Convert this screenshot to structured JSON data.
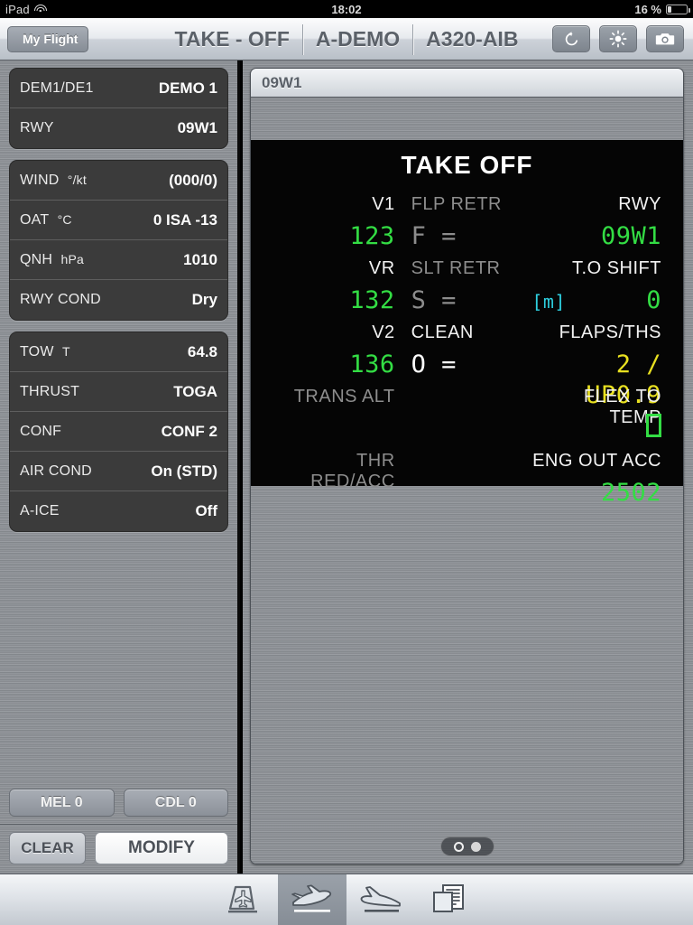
{
  "status_bar": {
    "device": "iPad",
    "wifi_icon": "wifi-icon",
    "time": "18:02",
    "battery_percent": "16 %",
    "battery_icon": "battery-low-icon"
  },
  "nav_bar": {
    "back_label": "My Flight",
    "title_segments": [
      "TAKE - OFF",
      "A-DEMO",
      "A320-AIB"
    ],
    "buttons": [
      {
        "name": "refresh-button",
        "icon": "refresh-icon"
      },
      {
        "name": "brightness-button",
        "icon": "brightness-icon"
      },
      {
        "name": "camera-button",
        "icon": "camera-icon"
      }
    ]
  },
  "sidebar": {
    "groups": [
      {
        "rows": [
          {
            "key": "DEM1/DE1",
            "unit": "",
            "value": "DEMO 1"
          },
          {
            "key": "RWY",
            "unit": "",
            "value": "09W1"
          }
        ]
      },
      {
        "rows": [
          {
            "key": "WIND",
            "unit": "°/kt",
            "value": "(000/0)"
          },
          {
            "key": "OAT",
            "unit": "°C",
            "value": "0 ISA -13"
          },
          {
            "key": "QNH",
            "unit": "hPa",
            "value": "1010"
          },
          {
            "key": "RWY COND",
            "unit": "",
            "value": "Dry"
          }
        ]
      },
      {
        "rows": [
          {
            "key": "TOW",
            "unit": "T",
            "value": "64.8"
          },
          {
            "key": "THRUST",
            "unit": "",
            "value": "TOGA"
          },
          {
            "key": "CONF",
            "unit": "",
            "value": "CONF 2"
          },
          {
            "key": "AIR COND",
            "unit": "",
            "value": "On (STD)"
          },
          {
            "key": "A-ICE",
            "unit": "",
            "value": "Off"
          }
        ]
      }
    ],
    "mel_label": "MEL 0",
    "cdl_label": "CDL 0",
    "clear_label": "CLEAR",
    "modify_label": "MODIFY"
  },
  "panel": {
    "header_title": "09W1",
    "display": {
      "title": "TAKE OFF",
      "rows": [
        {
          "left_label": "V1",
          "left_value": "123",
          "mid_label": "FLP RETR",
          "mid_value": "F =",
          "right_label": "RWY",
          "right_value": "09W1",
          "right_unit": ""
        },
        {
          "left_label": "VR",
          "left_value": "132",
          "mid_label": "SLT RETR",
          "mid_value": "S =",
          "right_label": "T.O SHIFT",
          "right_value": "0",
          "right_unit": "[m]"
        },
        {
          "left_label": "V2",
          "left_value": "136",
          "mid_label": "CLEAN",
          "mid_value": "O =",
          "right_label": "FLAPS/THS",
          "right_value": "2  / UP0.9",
          "right_unit": ""
        },
        {
          "left_label": "TRANS ALT",
          "left_value": "",
          "mid_label": "",
          "mid_value": "",
          "right_label": "FLEX TO TEMP",
          "right_value": "",
          "right_unit": ""
        },
        {
          "left_label": "THR RED/ACC",
          "left_value": "",
          "mid_label": "",
          "mid_value": "",
          "right_label": "ENG OUT ACC",
          "right_value": "2502",
          "right_unit": ""
        }
      ]
    },
    "page_dots": [
      "current",
      "other"
    ]
  },
  "tab_bar": {
    "tabs": [
      {
        "name": "tab-flight",
        "icon": "tailfin-aircraft-icon",
        "selected": false
      },
      {
        "name": "tab-takeoff",
        "icon": "aircraft-takeoff-icon",
        "selected": true
      },
      {
        "name": "tab-landing",
        "icon": "aircraft-landing-icon",
        "selected": false
      },
      {
        "name": "tab-documents",
        "icon": "documents-folder-icon",
        "selected": false
      }
    ]
  },
  "colors": {
    "green": "#33dd44",
    "yellow": "#e8e020",
    "cyan": "#2ed0e0",
    "dim": "#8d8d8d",
    "white": "#ffffff",
    "display_bg": "#050505"
  }
}
